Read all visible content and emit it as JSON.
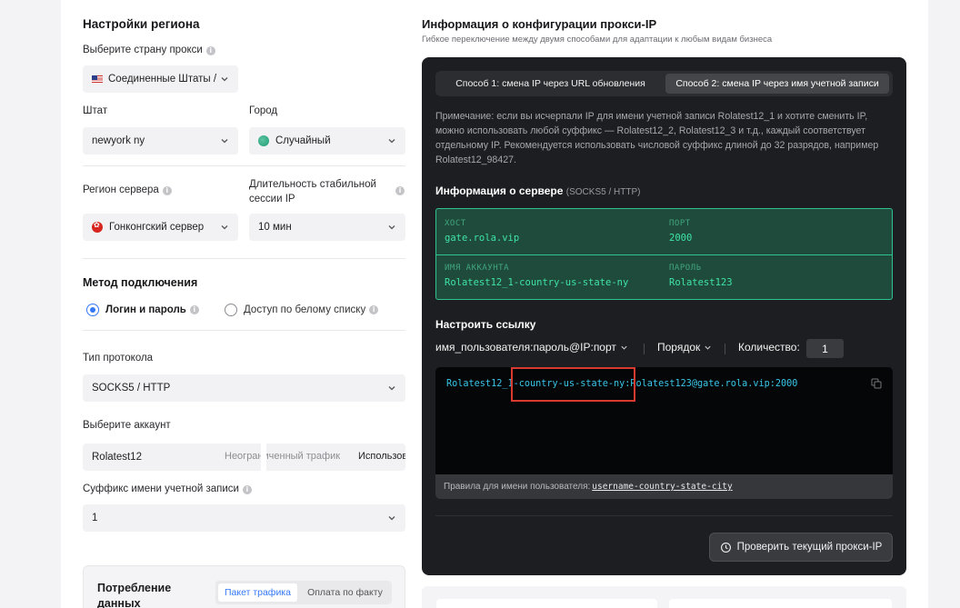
{
  "region": {
    "title": "Настройки региона",
    "country_label": "Выберите страну прокси",
    "country_value": "Соединенные Штаты /",
    "state_label": "Штат",
    "state_value": "newyork ny",
    "city_label": "Город",
    "city_value": "Случайный",
    "server_region_label": "Регион сервера",
    "server_region_value": "Гонконгский сервер",
    "session_label_line1": "Длительность стабильной",
    "session_label_line2": "сессии IP",
    "session_value": "10 мин"
  },
  "connection": {
    "title": "Метод подключения",
    "option_login": "Логин и пароль",
    "option_whitelist": "Доступ по белому списку",
    "protocol_label": "Тип протокола",
    "protocol_value": "SOCKS5 / HTTP",
    "account_label": "Выберите аккаунт",
    "account_value": "Rolatest12",
    "account_traffic": "Неограниченный трафик",
    "account_used": "Использование",
    "suffix_label": "Суффикс имени учетной записи",
    "suffix_value": "1"
  },
  "consumption": {
    "title_line1": "Потребление",
    "title_line2": "данных",
    "tab_traffic": "Пакет трафика",
    "tab_actual": "Оплата по факту"
  },
  "proxy_info": {
    "title": "Информация о конфигурации прокси-IP",
    "subtitle": "Гибкое переключение между двумя способами для адаптации к любым видам бизнеса",
    "tab1": "Способ 1: смена IP через URL обновления",
    "tab2": "Способ 2: смена IP через имя учетной записи",
    "note": "Примечание: если вы исчерпали IP для имени учетной записи Rolatest12_1 и хотите сменить IP, можно использовать любой суффикс — Rolatest12_2, Rolatest12_3 и т.д., каждый соответствует отдельному IP. Рекомендуется использовать числовой суффикс длиной до 32 разрядов, например Rolatest12_98427.",
    "server_title": "Информация о сервере",
    "server_proto": "(SOCKS5 / HTTP)",
    "host_key": "ХОСТ",
    "host_value": "gate.rola.vip",
    "port_key": "ПОРТ",
    "port_value": "2000",
    "account_key": "ИМЯ АККАУНТА",
    "account_value": "Rolatest12_1-country-us-state-ny",
    "password_key": "ПАРОЛЬ",
    "password_value": "Rolatest123",
    "link_title": "Настроить ссылку",
    "format_value": "имя_пользователя:пароль@IP:порт",
    "order_label": "Порядок",
    "quantity_label": "Количество:",
    "quantity_value": "1",
    "link_text": "Rolatest12_1-country-us-state-ny:Rolatest123@gate.rola.vip:2000",
    "rules_label": "Правила для имени пользователя:",
    "rules_value": "username-country-state-city",
    "check_button": "Проверить текущий прокси-IP"
  },
  "colors": {
    "accent": "#3478f6",
    "panel_dark": "#1d1e21",
    "server_green": "#3fe3a6",
    "link_cyan": "#39c6e8",
    "highlight_red": "#d93a2f"
  }
}
